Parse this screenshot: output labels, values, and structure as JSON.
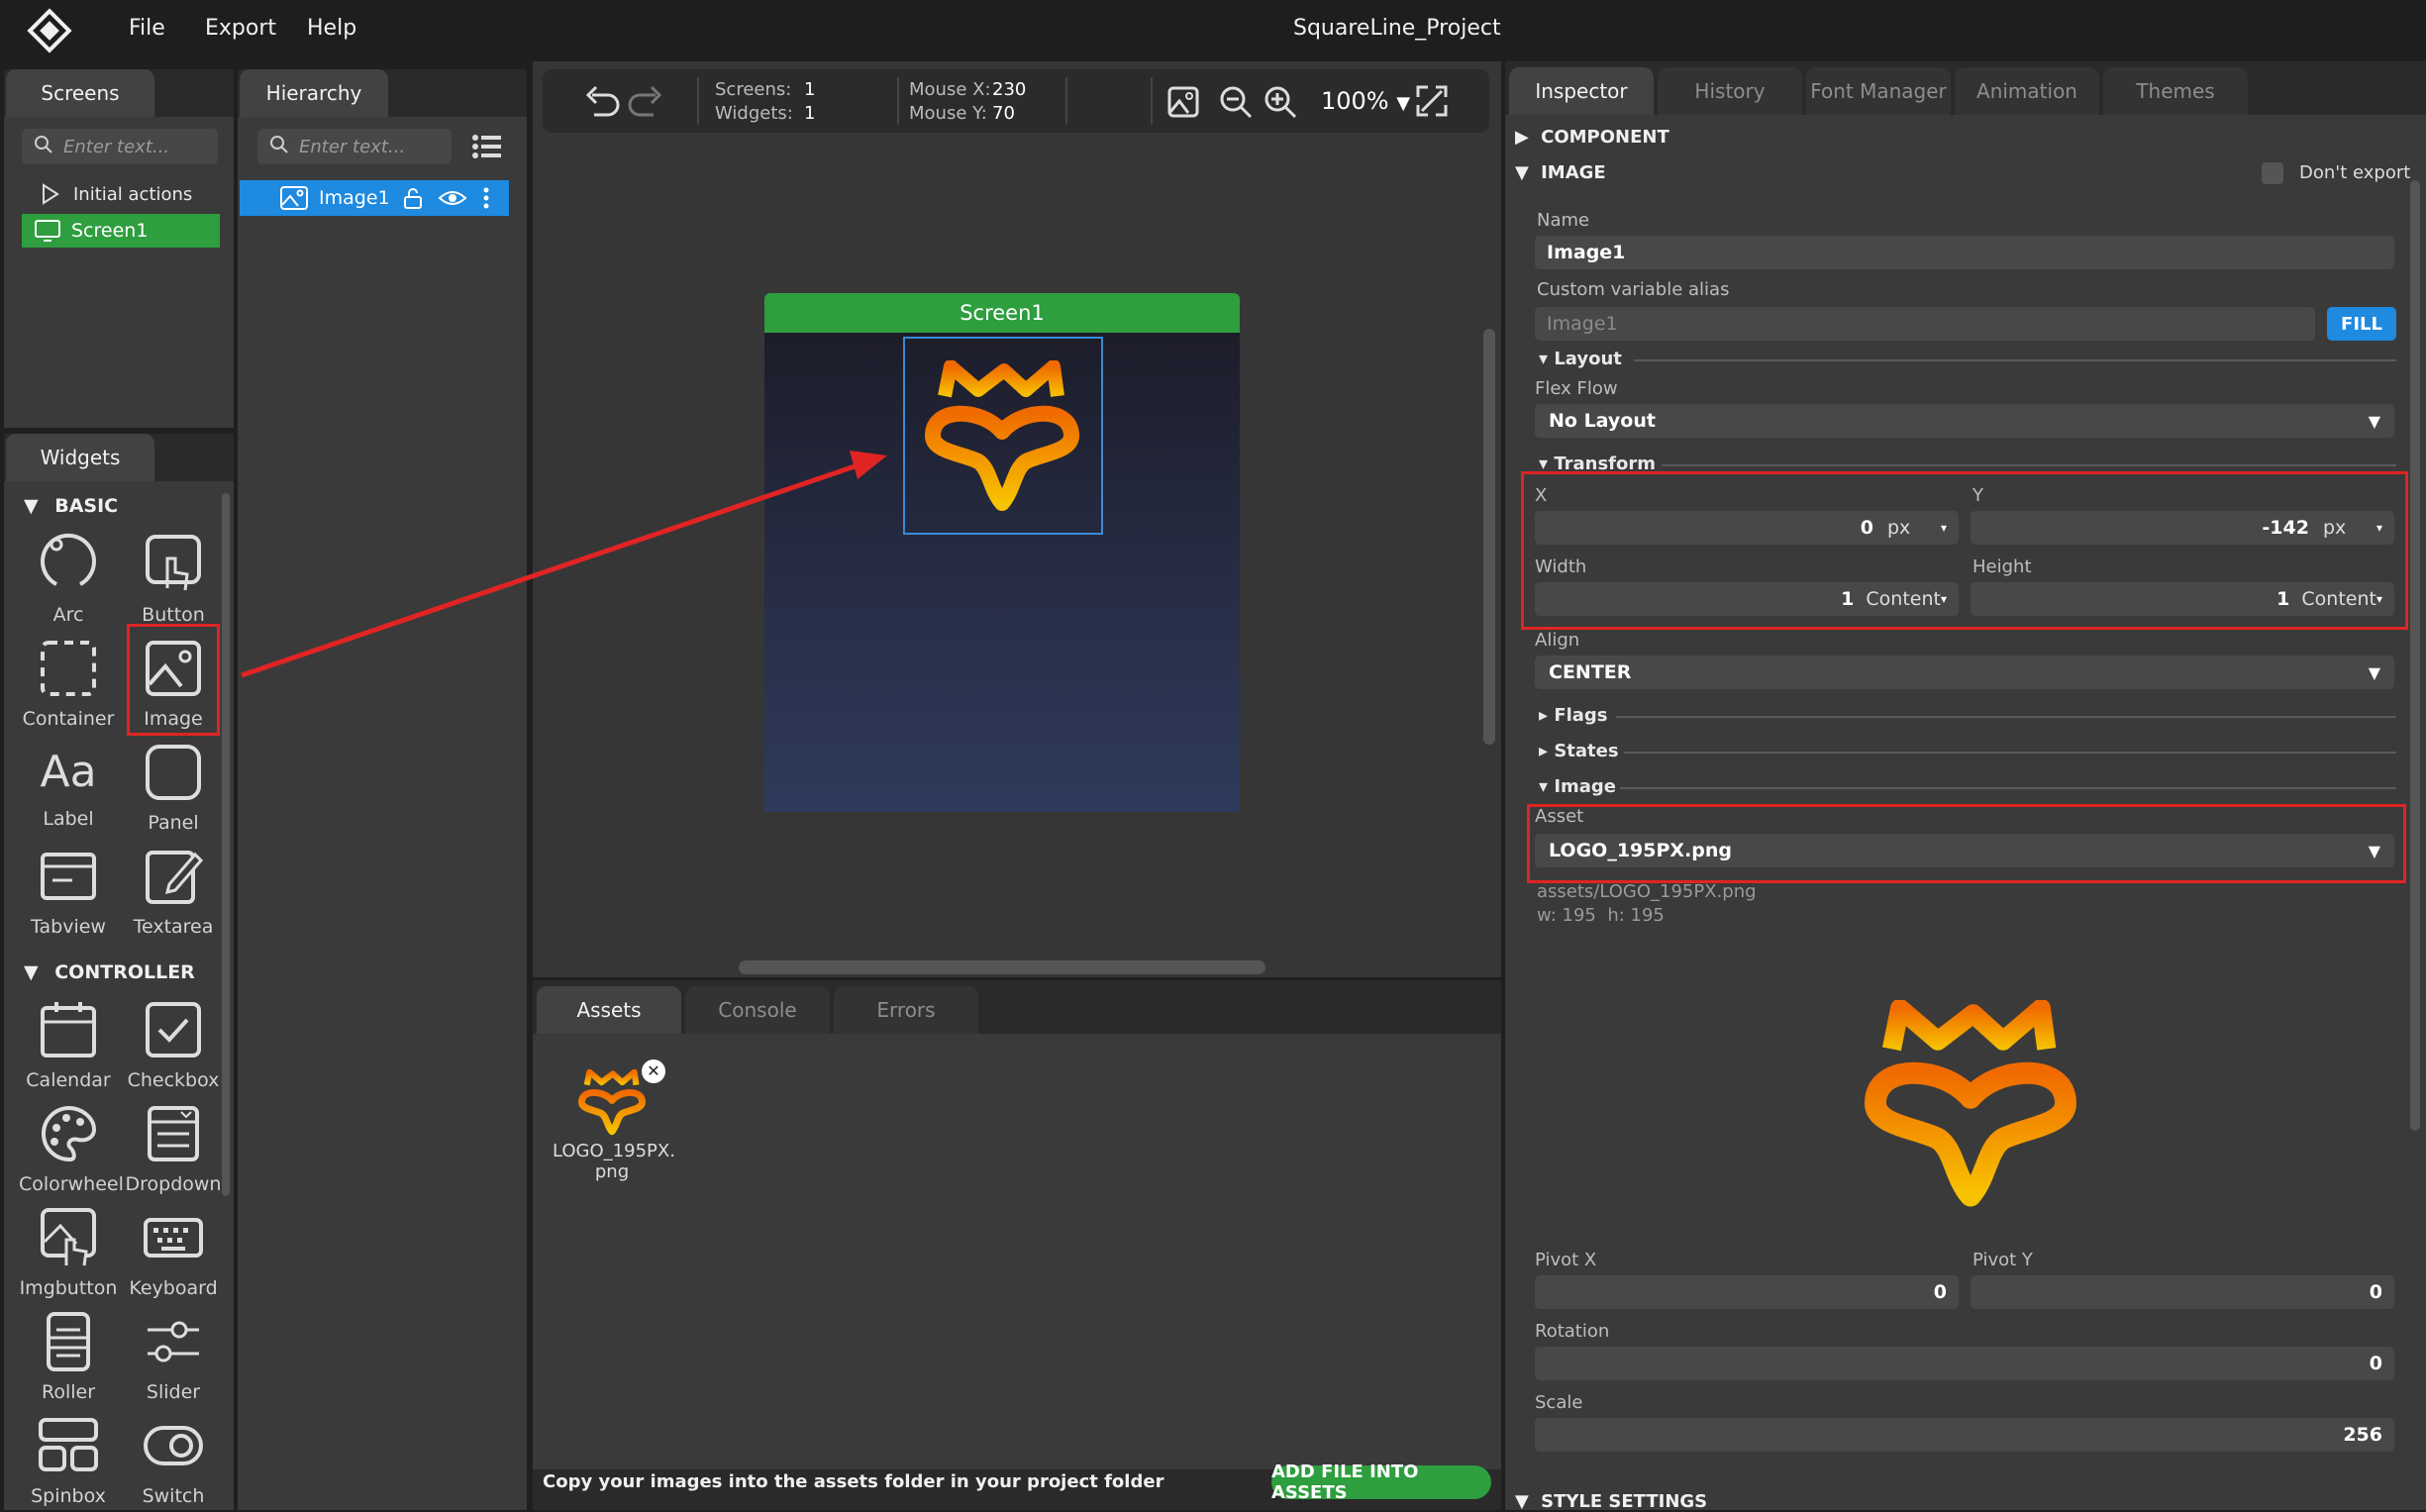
{
  "app": {
    "title": "SquareLine_Project",
    "menu": [
      "File",
      "Export",
      "Help"
    ]
  },
  "colors": {
    "accent_green": "#2e9e3e",
    "accent_blue": "#1e8ae0",
    "highlight_red": "#e02424",
    "logo_orange": "#f08a00",
    "logo_yellow": "#f6c000"
  },
  "screens_panel": {
    "tab": "Screens",
    "search_placeholder": "Enter text...",
    "items": [
      "Initial actions",
      "Screen1"
    ]
  },
  "hierarchy_panel": {
    "tab": "Hierarchy",
    "search_placeholder": "Enter text...",
    "items": [
      "Image1"
    ]
  },
  "toolbar": {
    "screens_label": "Screens:",
    "screens_value": "1",
    "widgets_label": "Widgets:",
    "widgets_value": "1",
    "mouse_x_label": "Mouse X:",
    "mouse_x_value": "230",
    "mouse_y_label": "Mouse Y:",
    "mouse_y_value": "70",
    "zoom": "100%"
  },
  "canvas": {
    "screen_title": "Screen1"
  },
  "widgets_panel": {
    "tab": "Widgets",
    "sections": [
      {
        "title": "BASIC",
        "items": [
          "Arc",
          "Button",
          "Container",
          "Image",
          "Label",
          "Panel",
          "Tabview",
          "Textarea"
        ]
      },
      {
        "title": "CONTROLLER",
        "items": [
          "Calendar",
          "Checkbox",
          "Colorwheel",
          "Dropdown",
          "Imgbutton",
          "Keyboard",
          "Roller",
          "Slider",
          "Spinbox",
          "Switch"
        ]
      }
    ]
  },
  "assets_panel": {
    "tabs": [
      "Assets",
      "Console",
      "Errors"
    ],
    "asset_name_line1": "LOGO_195PX.",
    "asset_name_line2": "png",
    "hint": "Copy your images into the assets folder in your project folder",
    "add_button": "ADD FILE INTO ASSETS"
  },
  "inspector": {
    "tabs": [
      "Inspector",
      "History",
      "Font Manager",
      "Animation",
      "Themes"
    ],
    "component_header": "COMPONENT",
    "image_header": "IMAGE",
    "dont_export": "Don't export",
    "name_label": "Name",
    "name_value": "Image1",
    "alias_label": "Custom variable alias",
    "alias_placeholder": "Image1",
    "fill_button": "FILL",
    "layout_label": "Layout",
    "flex_flow_label": "Flex Flow",
    "flex_flow_value": "No Layout",
    "transform_label": "Transform",
    "x_label": "X",
    "x_value": "0",
    "x_unit": "px",
    "y_label": "Y",
    "y_value": "-142",
    "y_unit": "px",
    "width_label": "Width",
    "width_value": "1",
    "width_unit": "Content",
    "height_label": "Height",
    "height_value": "1",
    "height_unit": "Content",
    "align_label": "Align",
    "align_value": "CENTER",
    "flags_label": "Flags",
    "states_label": "States",
    "image_sub_label": "Image",
    "asset_label": "Asset",
    "asset_value": "LOGO_195PX.png",
    "asset_path": "assets/LOGO_195PX.png",
    "asset_dims": "w: 195  h: 195",
    "pivot_x_label": "Pivot X",
    "pivot_x_value": "0",
    "pivot_y_label": "Pivot Y",
    "pivot_y_value": "0",
    "rotation_label": "Rotation",
    "rotation_value": "0",
    "scale_label": "Scale",
    "scale_value": "256",
    "style_settings": "STYLE SETTINGS"
  }
}
